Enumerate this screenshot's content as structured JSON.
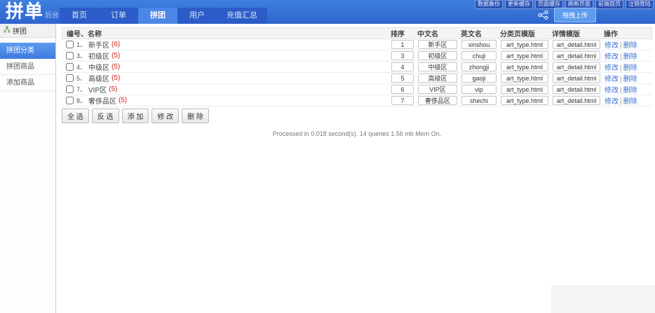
{
  "brand": {
    "title": "拼单",
    "subtitle": "后台"
  },
  "topbar": {
    "quick_links": [
      "数据备份",
      "更新缓存",
      "页面缓存",
      "刷新页面",
      "前端首页",
      "注销登陆"
    ],
    "upload_button": "拖拽上传"
  },
  "nav": {
    "tabs": [
      {
        "label": "首页",
        "active": false
      },
      {
        "label": "订单",
        "active": false
      },
      {
        "label": "拼团",
        "active": true
      },
      {
        "label": "用户",
        "active": false
      },
      {
        "label": "充值汇总",
        "active": false
      }
    ]
  },
  "sidebar": {
    "header": "拼团",
    "items": [
      {
        "label": "拼团分类",
        "active": true
      },
      {
        "label": "拼团商品",
        "active": false
      },
      {
        "label": "添加商品",
        "active": false
      }
    ]
  },
  "table": {
    "name_header": "编号、名称",
    "columns": [
      "排序",
      "中文名",
      "英文名",
      "分类页模版",
      "详情模版",
      "操作"
    ],
    "rows": [
      {
        "num": "1、",
        "title": "新手区",
        "count": "(6)",
        "sort": "1",
        "cn": "新手区",
        "en": "xinshou",
        "tpl_list": "art_type.html",
        "tpl_detail": "art_detail.html"
      },
      {
        "num": "3、",
        "title": "初级区",
        "count": "(5)",
        "sort": "3",
        "cn": "初级区",
        "en": "chuji",
        "tpl_list": "art_type.html",
        "tpl_detail": "art_detail.html"
      },
      {
        "num": "4、",
        "title": "中级区",
        "count": "(5)",
        "sort": "4",
        "cn": "中级区",
        "en": "zhongji",
        "tpl_list": "art_type.html",
        "tpl_detail": "art_detail.html"
      },
      {
        "num": "5、",
        "title": "高级区",
        "count": "(5)",
        "sort": "5",
        "cn": "高级区",
        "en": "gaoji",
        "tpl_list": "art_type.html",
        "tpl_detail": "art_detail.html"
      },
      {
        "num": "7、",
        "title": "VIP区",
        "count": "(5)",
        "sort": "6",
        "cn": "VIP区",
        "en": "vip",
        "tpl_list": "art_type.html",
        "tpl_detail": "art_detail.html"
      },
      {
        "num": "8、",
        "title": "奢侈品区",
        "count": "(5)",
        "sort": "7",
        "cn": "奢侈品区",
        "en": "shechi",
        "tpl_list": "art_type.html",
        "tpl_detail": "art_detail.html"
      }
    ],
    "actions": {
      "edit": "修改",
      "sep": "|",
      "delete": "删除"
    }
  },
  "toolbar": {
    "buttons": [
      "全 选",
      "反 选",
      "添 加",
      "修 改",
      "删 除"
    ]
  },
  "footer": {
    "stats": "Processed in 0.018 second(s). 14 queries 1.56 mb Mem On."
  },
  "colors": {
    "accent": "#3f7ce0",
    "topbar": "#2f64cd",
    "nav_band": "#2b5cc8",
    "active_tab": "#4c86e8",
    "count_red": "#cc2222",
    "link_blue": "#3b6fd0"
  }
}
